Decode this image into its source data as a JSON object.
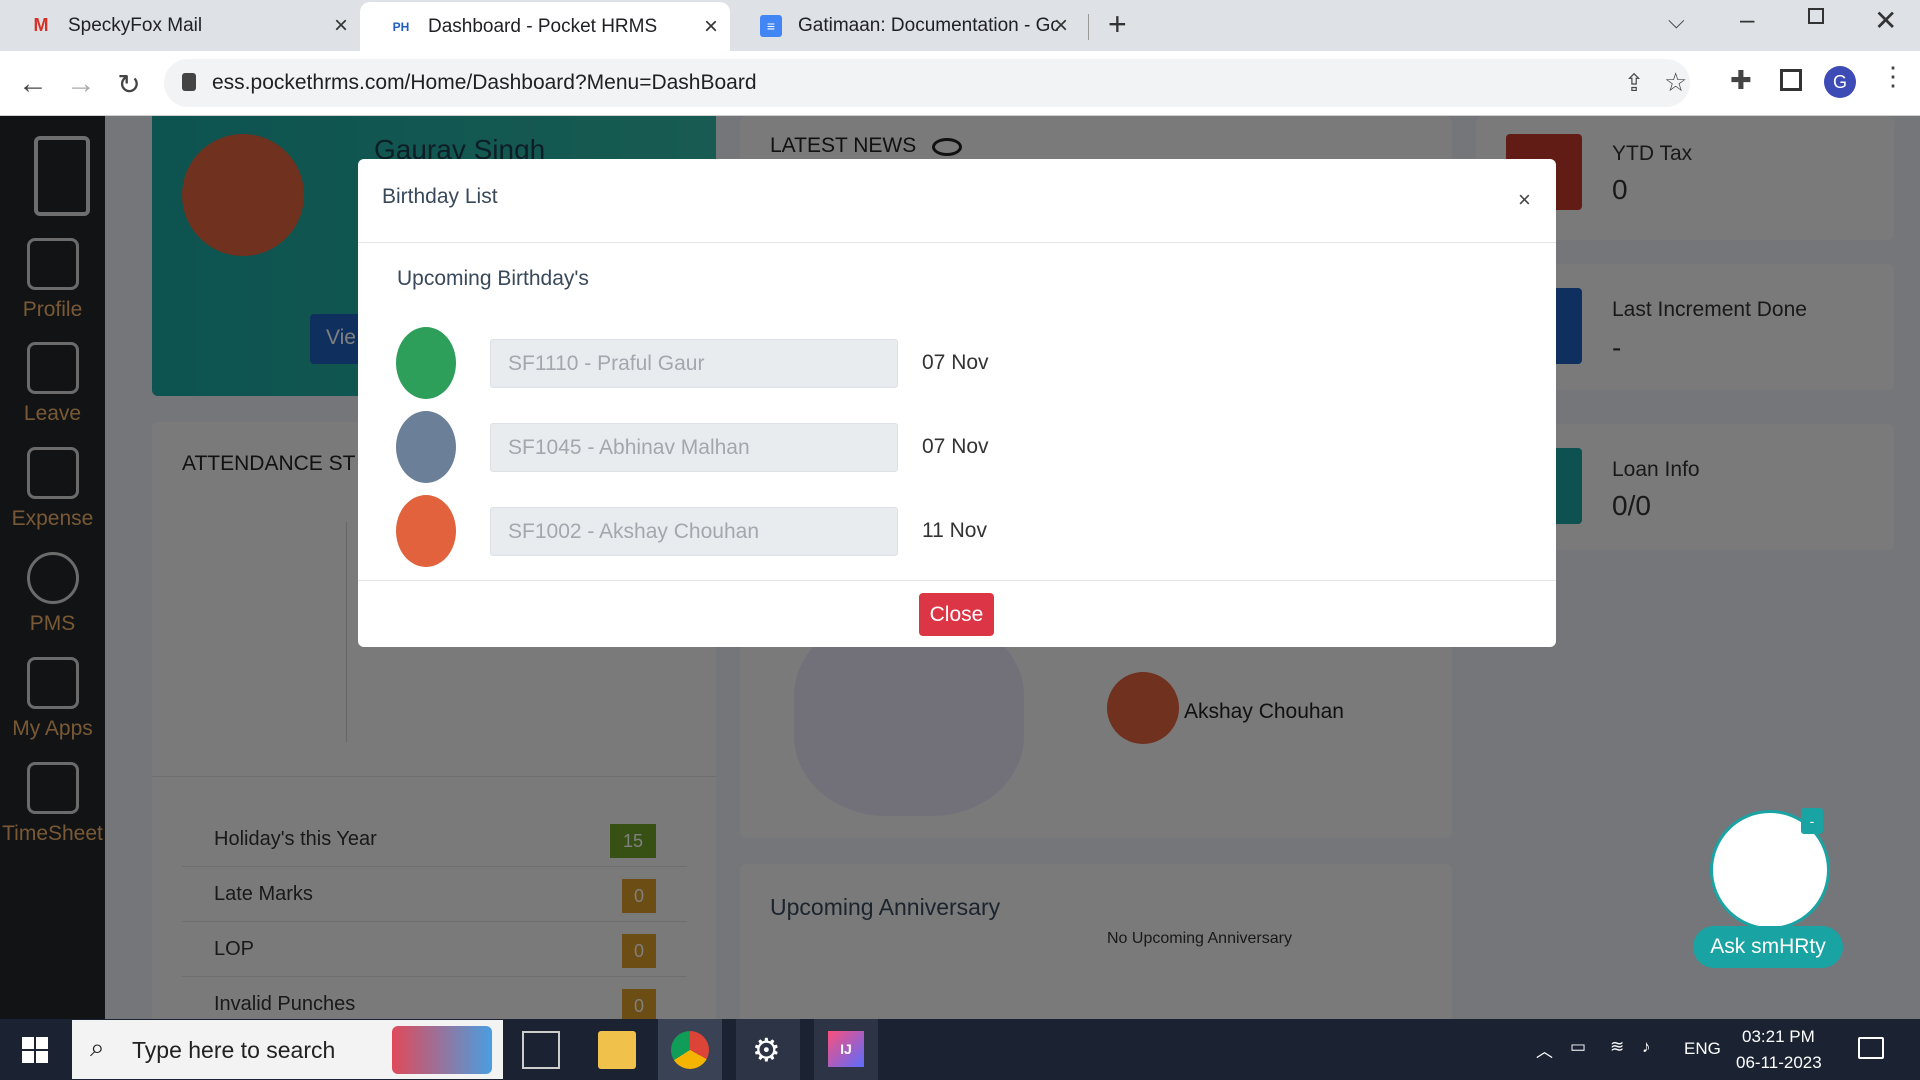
{
  "browser": {
    "tabs": [
      {
        "title": "SpeckyFox Mail",
        "icon": "gmail-icon",
        "active": false
      },
      {
        "title": "Dashboard - Pocket HRMS",
        "icon": "pocket-hrms-icon",
        "active": true
      },
      {
        "title": "Gatimaan: Documentation - Goo",
        "icon": "google-docs-icon",
        "active": false
      }
    ],
    "new_tab": "+",
    "url": "ess.pockethrms.com/Home/Dashboard?Menu=DashBoard",
    "profile_initial": "G"
  },
  "sidebar": {
    "items": [
      {
        "label": "Profile",
        "icon": "profile-icon"
      },
      {
        "label": "Leave",
        "icon": "leave-icon"
      },
      {
        "label": "Expense",
        "icon": "expense-icon"
      },
      {
        "label": "PMS",
        "icon": "pms-icon"
      },
      {
        "label": "My Apps",
        "icon": "apps-icon"
      },
      {
        "label": "TimeSheet",
        "icon": "timesheet-icon"
      }
    ]
  },
  "dashboard": {
    "user_name": "Gaurav Singh",
    "view_button": "Vie",
    "attendance_title": "ATTENDANCE ST",
    "stats": [
      {
        "label": "Holiday's this Year",
        "value": "15",
        "color": "#6fa32b"
      },
      {
        "label": "Late Marks",
        "value": "0",
        "color": "#d89a26"
      },
      {
        "label": "LOP",
        "value": "0",
        "color": "#d89a26"
      },
      {
        "label": "Invalid Punches",
        "value": "0",
        "color": "#d89a26"
      }
    ],
    "latest_news": "LATEST NEWS",
    "birthday_person": "Akshay Chouhan",
    "anniversary_title": "Upcoming Anniversary",
    "no_anniversary": "No Upcoming Anniversary",
    "info_cards": [
      {
        "label": "YTD Tax",
        "value": "0",
        "color": "#c0392b"
      },
      {
        "label": "Last Increment Done",
        "value": "-",
        "color": "#1f5fbf"
      },
      {
        "label": "Loan Info",
        "value": "0/0",
        "color": "#1aa3a3"
      }
    ]
  },
  "modal": {
    "title": "Birthday List",
    "close_x": "×",
    "subtitle": "Upcoming Birthday's",
    "birthdays": [
      {
        "name": "SF1110 - Praful Gaur",
        "date": "07 Nov",
        "avatar_color": "#2e9e5b"
      },
      {
        "name": "SF1045 - Abhinav Malhan",
        "date": "07 Nov",
        "avatar_color": "#6b7f99"
      },
      {
        "name": "SF1002 - Akshay Chouhan",
        "date": "11 Nov",
        "avatar_color": "#e1623c"
      }
    ],
    "close_button": "Close"
  },
  "chatbot": {
    "label": "Ask smHRty",
    "badge": "-"
  },
  "taskbar": {
    "search_placeholder": "Type here to search",
    "language": "ENG",
    "time": "03:21 PM",
    "date": "06-11-2023"
  }
}
